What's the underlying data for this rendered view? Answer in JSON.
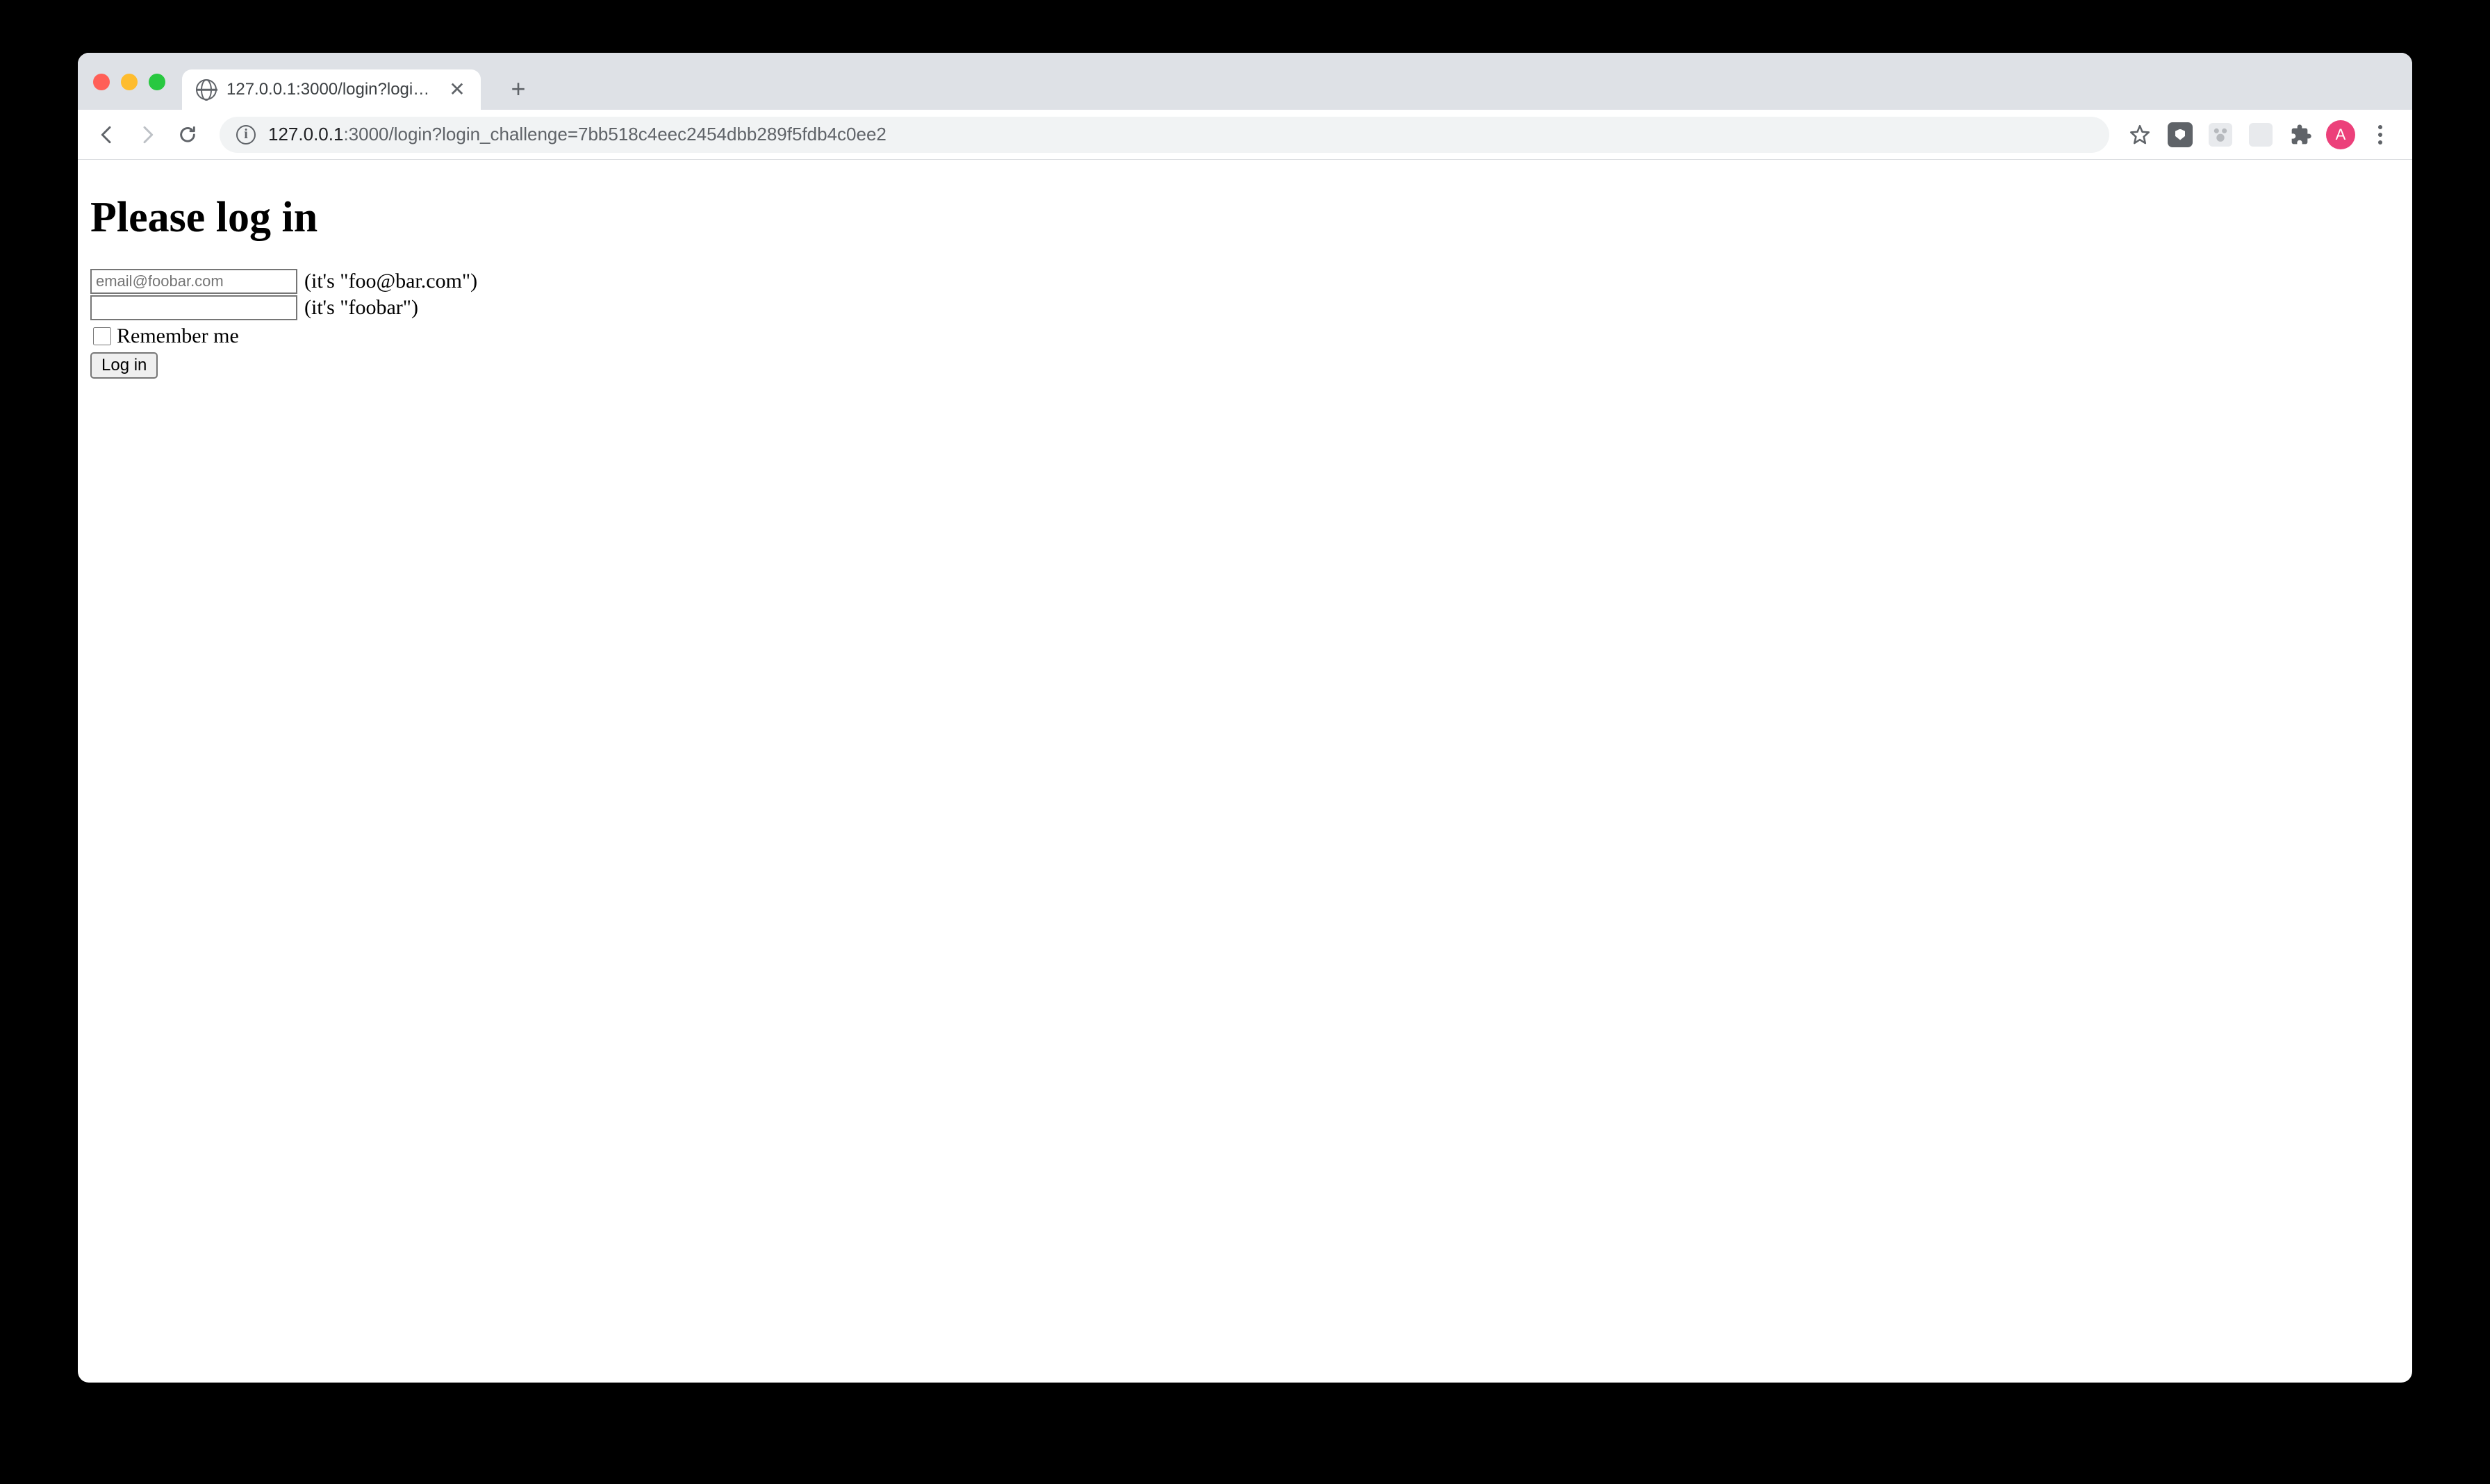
{
  "browser": {
    "tab": {
      "title": "127.0.0.1:3000/login?login_ch…"
    },
    "address": {
      "host": "127.0.0.1",
      "path": ":3000/login?login_challenge=7bb518c4eec2454dbb289f5fdb4c0ee2"
    },
    "avatar_letter": "A"
  },
  "page": {
    "heading": "Please log in",
    "email_placeholder": "email@foobar.com",
    "email_hint": "(it's \"foo@bar.com\")",
    "password_hint": "(it's \"foobar\")",
    "remember_label": "Remember me",
    "submit_label": "Log in"
  }
}
